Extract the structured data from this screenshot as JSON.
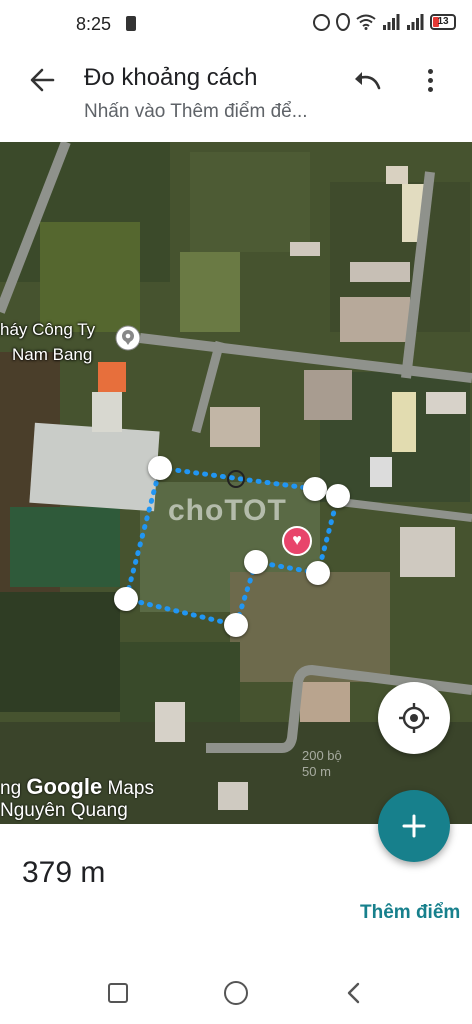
{
  "status_bar": {
    "time": "8:25",
    "battery": "13",
    "icons": [
      "notification-icon",
      "alarm-icon",
      "location-icon",
      "wifi-icon",
      "signal-icon",
      "signal-icon",
      "battery-icon"
    ]
  },
  "toolbar": {
    "title": "Đo khoảng cách",
    "subtitle": "Nhấn vào Thêm điểm để...",
    "back_icon": "arrow-back-icon",
    "undo_icon": "undo-icon",
    "more_icon": "more-vert-icon"
  },
  "map": {
    "place_label_line1": "háy Công Ty",
    "place_label_line2": "Nam Bang",
    "watermark": "choTOT",
    "attribution_left": "ng",
    "attribution_brand": "Google",
    "attribution_product": "Maps",
    "attribution_line2": "Nguyên Quang",
    "scale_top": "200 bộ",
    "scale_bottom": "50 m"
  },
  "measure": {
    "distance": "379 m",
    "add_point_label": "Thêm điểm"
  },
  "colors": {
    "accent": "#17808c",
    "measure_line": "#2196f3",
    "heart": "#e8456b"
  }
}
